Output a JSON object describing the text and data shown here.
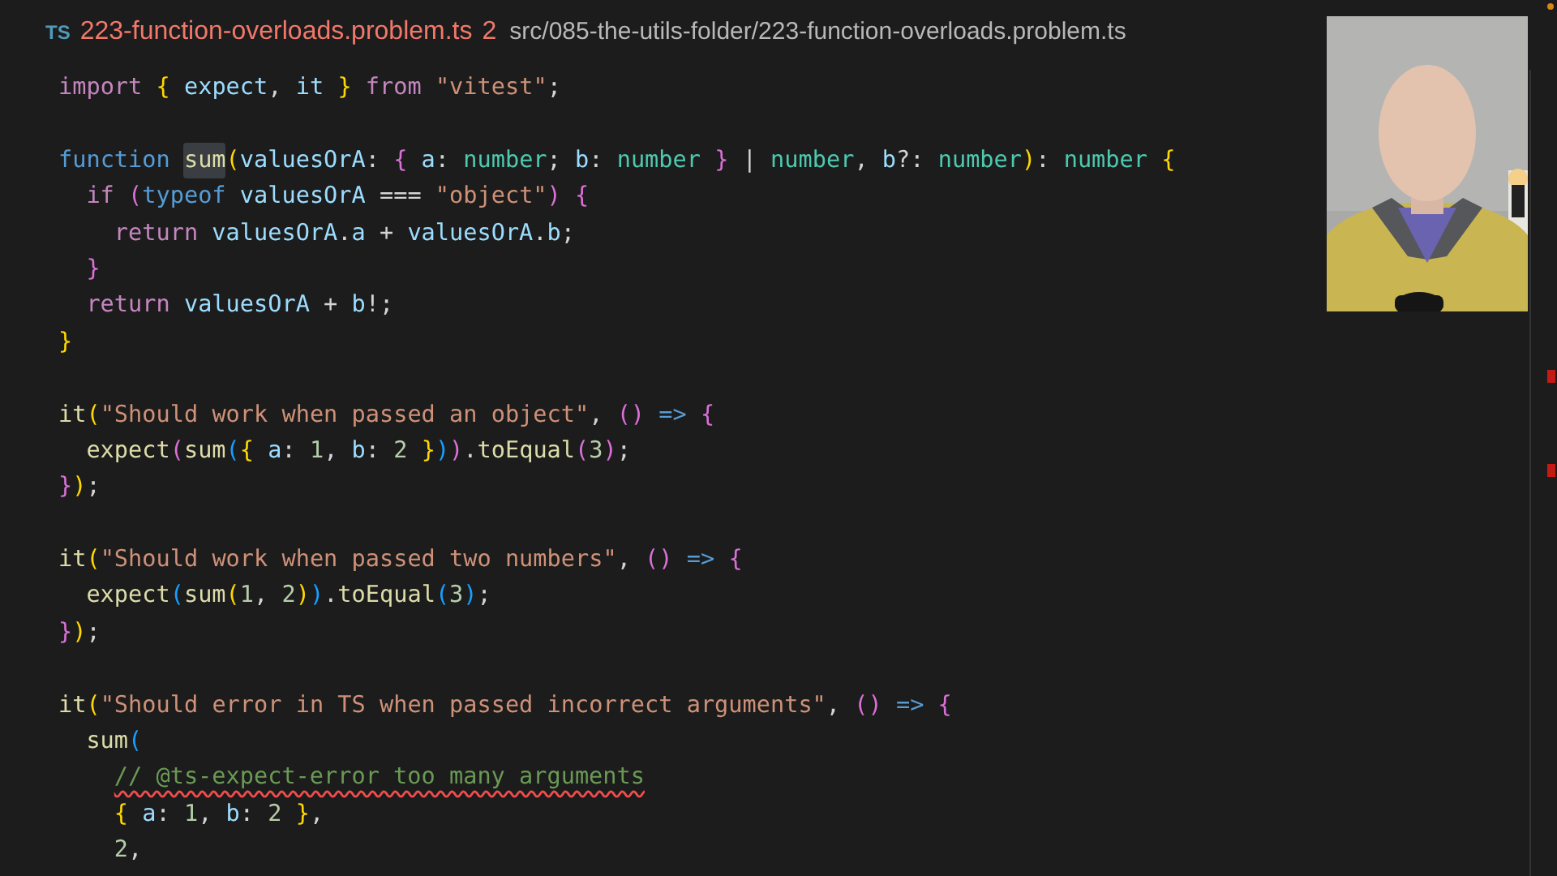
{
  "breadcrumb": {
    "file_icon": "TS",
    "file_name": "223-function-overloads.problem.ts",
    "problem_count": "2",
    "path": "src/085-the-utils-folder/223-function-overloads.problem.ts"
  },
  "code_blocks": [
    {
      "lines": [
        {
          "tokens": [
            {
              "kind": "keyword",
              "text": "import "
            },
            {
              "kind": "bracket1",
              "text": "{"
            },
            {
              "kind": "variable",
              "text": " expect"
            },
            {
              "kind": "punct",
              "text": ", "
            },
            {
              "kind": "variable",
              "text": "it "
            },
            {
              "kind": "bracket1",
              "text": "}"
            },
            {
              "kind": "keyword",
              "text": " from "
            },
            {
              "kind": "string",
              "text": "\"vitest\""
            },
            {
              "kind": "punct",
              "text": ";"
            }
          ]
        }
      ]
    },
    {
      "lines": [
        {
          "tokens": [
            {
              "kind": "storage",
              "text": "function "
            },
            {
              "kind": "function",
              "text": "sum",
              "highlighted": true
            },
            {
              "kind": "bracket1",
              "text": "("
            },
            {
              "kind": "variable",
              "text": "valuesOrA"
            },
            {
              "kind": "punct",
              "text": ": "
            },
            {
              "kind": "bracket2",
              "text": "{"
            },
            {
              "kind": "variable",
              "text": " a"
            },
            {
              "kind": "punct",
              "text": ": "
            },
            {
              "kind": "type",
              "text": "number"
            },
            {
              "kind": "punct",
              "text": "; "
            },
            {
              "kind": "variable",
              "text": "b"
            },
            {
              "kind": "punct",
              "text": ": "
            },
            {
              "kind": "type",
              "text": "number "
            },
            {
              "kind": "bracket2",
              "text": "}"
            },
            {
              "kind": "punct",
              "text": " | "
            },
            {
              "kind": "type",
              "text": "number"
            },
            {
              "kind": "punct",
              "text": ", "
            },
            {
              "kind": "variable",
              "text": "b"
            },
            {
              "kind": "punct",
              "text": "?: "
            },
            {
              "kind": "type",
              "text": "number"
            },
            {
              "kind": "bracket1",
              "text": ")"
            },
            {
              "kind": "punct",
              "text": ": "
            },
            {
              "kind": "type",
              "text": "number "
            },
            {
              "kind": "bracket1",
              "text": "{"
            }
          ],
          "children": [
            {
              "tokens": [
                {
                  "kind": "keyword",
                  "text": "if "
                },
                {
                  "kind": "bracket2",
                  "text": "("
                },
                {
                  "kind": "storage",
                  "text": "typeof "
                },
                {
                  "kind": "variable",
                  "text": "valuesOrA "
                },
                {
                  "kind": "punct",
                  "text": "=== "
                },
                {
                  "kind": "string",
                  "text": "\"object\""
                },
                {
                  "kind": "bracket2",
                  "text": ")"
                },
                {
                  "kind": "bracket2",
                  "text": " {"
                }
              ],
              "children": [
                {
                  "tokens": [
                    {
                      "kind": "keyword",
                      "text": "return "
                    },
                    {
                      "kind": "variable",
                      "text": "valuesOrA"
                    },
                    {
                      "kind": "punct",
                      "text": "."
                    },
                    {
                      "kind": "variable",
                      "text": "a"
                    },
                    {
                      "kind": "punct",
                      "text": " + "
                    },
                    {
                      "kind": "variable",
                      "text": "valuesOrA"
                    },
                    {
                      "kind": "punct",
                      "text": "."
                    },
                    {
                      "kind": "variable",
                      "text": "b"
                    },
                    {
                      "kind": "punct",
                      "text": ";"
                    }
                  ]
                }
              ]
            },
            {
              "tokens": [
                {
                  "kind": "bracket2",
                  "text": "}"
                }
              ]
            },
            {
              "tokens": [
                {
                  "kind": "keyword",
                  "text": "return "
                },
                {
                  "kind": "variable",
                  "text": "valuesOrA"
                },
                {
                  "kind": "punct",
                  "text": " + "
                },
                {
                  "kind": "variable",
                  "text": "b"
                },
                {
                  "kind": "punct",
                  "text": "!;"
                }
              ]
            }
          ]
        },
        {
          "tokens": [
            {
              "kind": "bracket1",
              "text": "}"
            }
          ]
        }
      ]
    },
    {
      "lines": [
        {
          "tokens": [
            {
              "kind": "function",
              "text": "it"
            },
            {
              "kind": "bracket1",
              "text": "("
            },
            {
              "kind": "string",
              "text": "\"Should work when passed an object\""
            },
            {
              "kind": "punct",
              "text": ", "
            },
            {
              "kind": "bracket2",
              "text": "()"
            },
            {
              "kind": "storage",
              "text": " => "
            },
            {
              "kind": "bracket2",
              "text": "{"
            }
          ],
          "children": [
            {
              "tokens": [
                {
                  "kind": "function",
                  "text": "expect"
                },
                {
                  "kind": "bracket2",
                  "text": "("
                },
                {
                  "kind": "function",
                  "text": "sum"
                },
                {
                  "kind": "bracket3",
                  "text": "("
                },
                {
                  "kind": "bracket1",
                  "text": "{"
                },
                {
                  "kind": "variable",
                  "text": " a"
                },
                {
                  "kind": "punct",
                  "text": ": "
                },
                {
                  "kind": "number",
                  "text": "1"
                },
                {
                  "kind": "punct",
                  "text": ", "
                },
                {
                  "kind": "variable",
                  "text": "b"
                },
                {
                  "kind": "punct",
                  "text": ": "
                },
                {
                  "kind": "number",
                  "text": "2 "
                },
                {
                  "kind": "bracket1",
                  "text": "}"
                },
                {
                  "kind": "bracket3",
                  "text": ")"
                },
                {
                  "kind": "bracket2",
                  "text": ")"
                },
                {
                  "kind": "punct",
                  "text": "."
                },
                {
                  "kind": "function",
                  "text": "toEqual"
                },
                {
                  "kind": "bracket2",
                  "text": "("
                },
                {
                  "kind": "number",
                  "text": "3"
                },
                {
                  "kind": "bracket2",
                  "text": ")"
                },
                {
                  "kind": "punct",
                  "text": ";"
                }
              ]
            }
          ]
        },
        {
          "tokens": [
            {
              "kind": "bracket2",
              "text": "}"
            },
            {
              "kind": "bracket1",
              "text": ")"
            },
            {
              "kind": "punct",
              "text": ";"
            }
          ]
        }
      ]
    },
    {
      "lines": [
        {
          "tokens": [
            {
              "kind": "function",
              "text": "it"
            },
            {
              "kind": "bracket1",
              "text": "("
            },
            {
              "kind": "string",
              "text": "\"Should work when passed two numbers\""
            },
            {
              "kind": "punct",
              "text": ", "
            },
            {
              "kind": "bracket2",
              "text": "()"
            },
            {
              "kind": "storage",
              "text": " => "
            },
            {
              "kind": "bracket2",
              "text": "{"
            }
          ],
          "children": [
            {
              "tokens": [
                {
                  "kind": "function",
                  "text": "expect"
                },
                {
                  "kind": "bracket3",
                  "text": "("
                },
                {
                  "kind": "function",
                  "text": "sum"
                },
                {
                  "kind": "bracket1",
                  "text": "("
                },
                {
                  "kind": "number",
                  "text": "1"
                },
                {
                  "kind": "punct",
                  "text": ", "
                },
                {
                  "kind": "number",
                  "text": "2"
                },
                {
                  "kind": "bracket1",
                  "text": ")"
                },
                {
                  "kind": "bracket3",
                  "text": ")"
                },
                {
                  "kind": "punct",
                  "text": "."
                },
                {
                  "kind": "function",
                  "text": "toEqual"
                },
                {
                  "kind": "bracket3",
                  "text": "("
                },
                {
                  "kind": "number",
                  "text": "3"
                },
                {
                  "kind": "bracket3",
                  "text": ")"
                },
                {
                  "kind": "punct",
                  "text": ";"
                }
              ]
            }
          ]
        },
        {
          "tokens": [
            {
              "kind": "bracket2",
              "text": "}"
            },
            {
              "kind": "bracket1",
              "text": ")"
            },
            {
              "kind": "punct",
              "text": ";"
            }
          ]
        }
      ]
    },
    {
      "lines": [
        {
          "tokens": [
            {
              "kind": "function",
              "text": "it"
            },
            {
              "kind": "bracket1",
              "text": "("
            },
            {
              "kind": "string",
              "text": "\"Should error in TS when passed incorrect arguments\""
            },
            {
              "kind": "punct",
              "text": ", "
            },
            {
              "kind": "bracket2",
              "text": "()"
            },
            {
              "kind": "storage",
              "text": " => "
            },
            {
              "kind": "bracket2",
              "text": "{"
            }
          ],
          "children": [
            {
              "tokens": [
                {
                  "kind": "function",
                  "text": "sum"
                },
                {
                  "kind": "bracket3",
                  "text": "("
                }
              ],
              "children": [
                {
                  "tokens": [
                    {
                      "kind": "comment",
                      "text": "// @ts-expect-error too many arguments",
                      "error": true
                    }
                  ]
                },
                {
                  "tokens": [
                    {
                      "kind": "bracket1",
                      "text": "{"
                    },
                    {
                      "kind": "variable",
                      "text": " a"
                    },
                    {
                      "kind": "punct",
                      "text": ": "
                    },
                    {
                      "kind": "number",
                      "text": "1"
                    },
                    {
                      "kind": "punct",
                      "text": ", "
                    },
                    {
                      "kind": "variable",
                      "text": "b"
                    },
                    {
                      "kind": "punct",
                      "text": ": "
                    },
                    {
                      "kind": "number",
                      "text": "2 "
                    },
                    {
                      "kind": "bracket1",
                      "text": "}"
                    },
                    {
                      "kind": "punct",
                      "text": ","
                    }
                  ]
                },
                {
                  "tokens": [
                    {
                      "kind": "number",
                      "text": "2"
                    },
                    {
                      "kind": "punct",
                      "text": ","
                    }
                  ]
                }
              ]
            }
          ]
        }
      ]
    }
  ]
}
